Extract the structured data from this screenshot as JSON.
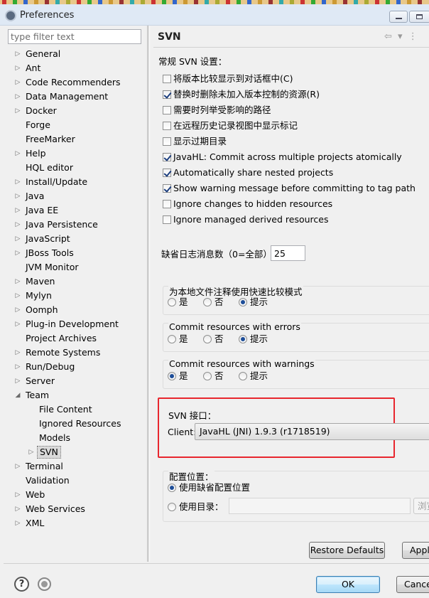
{
  "window": {
    "title": "Preferences",
    "minimize_icon": "minimize-icon",
    "maximize_icon": "maximize-icon"
  },
  "filter": {
    "placeholder": "type filter text",
    "value": ""
  },
  "tree": [
    {
      "label": "General",
      "expander": "▷"
    },
    {
      "label": "Ant",
      "expander": "▷"
    },
    {
      "label": "Code Recommenders",
      "expander": "▷"
    },
    {
      "label": "Data Management",
      "expander": "▷"
    },
    {
      "label": "Docker",
      "expander": "▷"
    },
    {
      "label": "Forge",
      "expander": ""
    },
    {
      "label": "FreeMarker",
      "expander": ""
    },
    {
      "label": "Help",
      "expander": "▷"
    },
    {
      "label": "HQL editor",
      "expander": ""
    },
    {
      "label": "Install/Update",
      "expander": "▷"
    },
    {
      "label": "Java",
      "expander": "▷"
    },
    {
      "label": "Java EE",
      "expander": "▷"
    },
    {
      "label": "Java Persistence",
      "expander": "▷"
    },
    {
      "label": "JavaScript",
      "expander": "▷"
    },
    {
      "label": "JBoss Tools",
      "expander": "▷"
    },
    {
      "label": "JVM Monitor",
      "expander": ""
    },
    {
      "label": "Maven",
      "expander": "▷"
    },
    {
      "label": "Mylyn",
      "expander": "▷"
    },
    {
      "label": "Oomph",
      "expander": "▷"
    },
    {
      "label": "Plug-in Development",
      "expander": "▷"
    },
    {
      "label": "Project Archives",
      "expander": ""
    },
    {
      "label": "Remote Systems",
      "expander": "▷"
    },
    {
      "label": "Run/Debug",
      "expander": "▷"
    },
    {
      "label": "Server",
      "expander": "▷"
    },
    {
      "label": "Team",
      "expander": "◢"
    },
    {
      "label": "File Content",
      "expander": ""
    },
    {
      "label": "Ignored Resources",
      "expander": ""
    },
    {
      "label": "Models",
      "expander": ""
    },
    {
      "label": "SVN",
      "expander": "▷"
    },
    {
      "label": "Terminal",
      "expander": "▷"
    },
    {
      "label": "Validation",
      "expander": ""
    },
    {
      "label": "Web",
      "expander": "▷"
    },
    {
      "label": "Web Services",
      "expander": "▷"
    },
    {
      "label": "XML",
      "expander": "▷"
    }
  ],
  "page": {
    "title": "SVN",
    "nav_back": "⇦",
    "nav_dropdown": "▾",
    "nav_menu": "⋮",
    "general_label": "常规 SVN 设置：",
    "checkboxes": [
      {
        "label": "将版本比较显示到对话框中(C)",
        "checked": false
      },
      {
        "label": "替换时删除未加入版本控制的资源(R)",
        "checked": true
      },
      {
        "label": "需要时列举受影响的路径",
        "checked": false
      },
      {
        "label": "在远程历史记录视图中显示标记",
        "checked": false
      },
      {
        "label": "显示过期目录",
        "checked": false
      },
      {
        "label": "JavaHL: Commit across multiple projects atomically",
        "checked": true
      },
      {
        "label": "Automatically share nested projects",
        "checked": true
      },
      {
        "label": "Show warning message before committing to tag path",
        "checked": true
      },
      {
        "label": "Ignore changes to hidden resources",
        "checked": false
      },
      {
        "label": "Ignore managed derived resources",
        "checked": false
      }
    ],
    "log_count_label": "缺省日志消息数（0=全部）",
    "log_count_value": "25",
    "groups": [
      {
        "title": "为本地文件注释使用快速比较模式",
        "options": [
          "是",
          "否",
          "提示"
        ],
        "selected": 2
      },
      {
        "title": "Commit resources with errors",
        "options": [
          "是",
          "否",
          "提示"
        ],
        "selected": 2
      },
      {
        "title": "Commit resources with warnings",
        "options": [
          "是",
          "否",
          "提示"
        ],
        "selected": 0
      }
    ],
    "svn_interface": {
      "label": "SVN 接口：",
      "client_label": "Client:",
      "client_value": "JavaHL (JNI) 1.9.3 (r1718519)",
      "highlight_color": "#e8262e"
    },
    "config_location": {
      "label": "配置位置：",
      "option_default": "使用缺省配置位置",
      "option_dir": "使用目录：",
      "selected": 0,
      "dir_value": "",
      "browse_label": "浏览"
    },
    "restore_defaults": "Restore Defaults",
    "apply": "Apply"
  },
  "footer": {
    "ok": "OK",
    "cancel": "Cancel",
    "help_icon": "help-icon",
    "import_icon": "import-export-icon"
  },
  "colors": {
    "accent": "#1d4d98",
    "selection": "#dadada",
    "ok_button": "#bee6fd"
  }
}
